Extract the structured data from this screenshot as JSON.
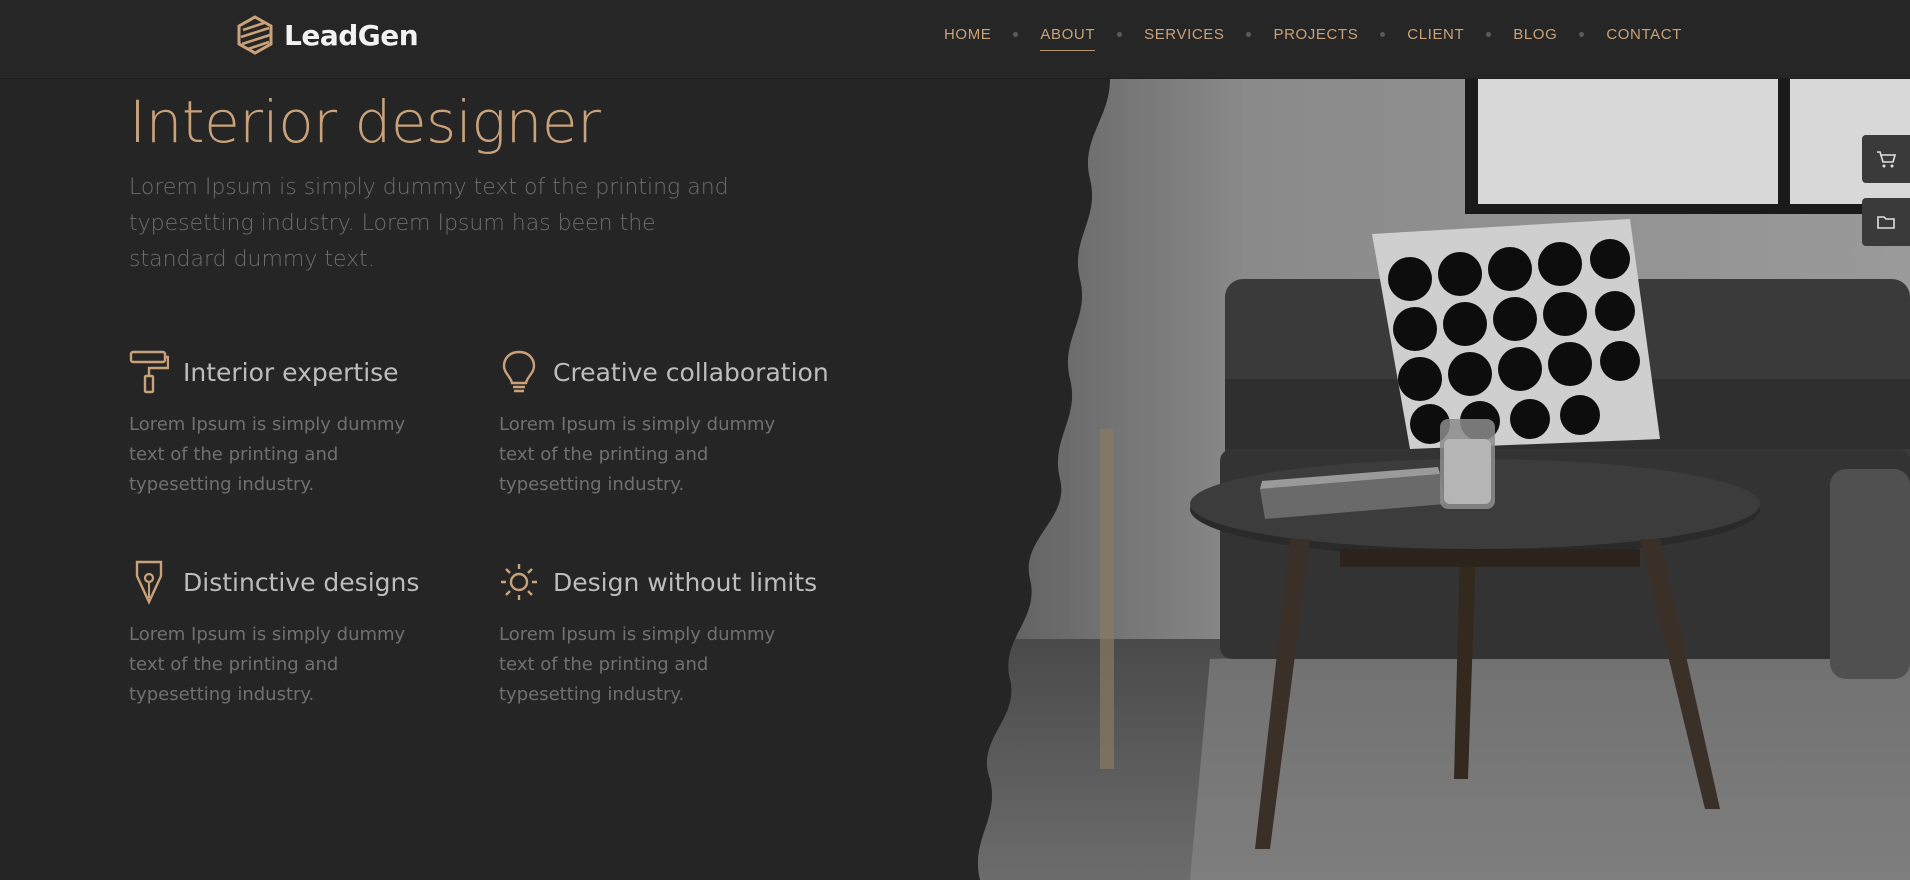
{
  "brand": {
    "name": "LeadGen",
    "accent": "#c9a27a"
  },
  "nav": {
    "items": [
      {
        "label": "HOME"
      },
      {
        "label": "ABOUT",
        "active": true
      },
      {
        "label": "SERVICES"
      },
      {
        "label": "PROJECTS"
      },
      {
        "label": "CLIENT"
      },
      {
        "label": "BLOG"
      },
      {
        "label": "CONTACT"
      }
    ]
  },
  "hero": {
    "title": "Interior designer",
    "lead": "Lorem Ipsum is simply dummy text of the printing and typesetting industry. Lorem Ipsum has been the standard dummy text."
  },
  "features": [
    {
      "icon": "paint-roller-icon",
      "title": "Interior expertise",
      "text": "Lorem Ipsum is simply dummy text of the printing and typesetting industry."
    },
    {
      "icon": "lightbulb-icon",
      "title": "Creative collaboration",
      "text": "Lorem Ipsum is simply dummy text of the printing and typesetting industry."
    },
    {
      "icon": "pen-nib-icon",
      "title": "Distinctive designs",
      "text": "Lorem Ipsum is simply dummy text of the printing and typesetting industry."
    },
    {
      "icon": "sun-icon",
      "title": "Design without limits",
      "text": "Lorem Ipsum is simply dummy text of the printing and typesetting industry."
    }
  ],
  "side_buttons": [
    {
      "icon": "cart-icon"
    },
    {
      "icon": "folder-icon"
    }
  ],
  "colors": {
    "background": "#252525",
    "accent": "#c9a27a",
    "text_muted": "#707070"
  }
}
